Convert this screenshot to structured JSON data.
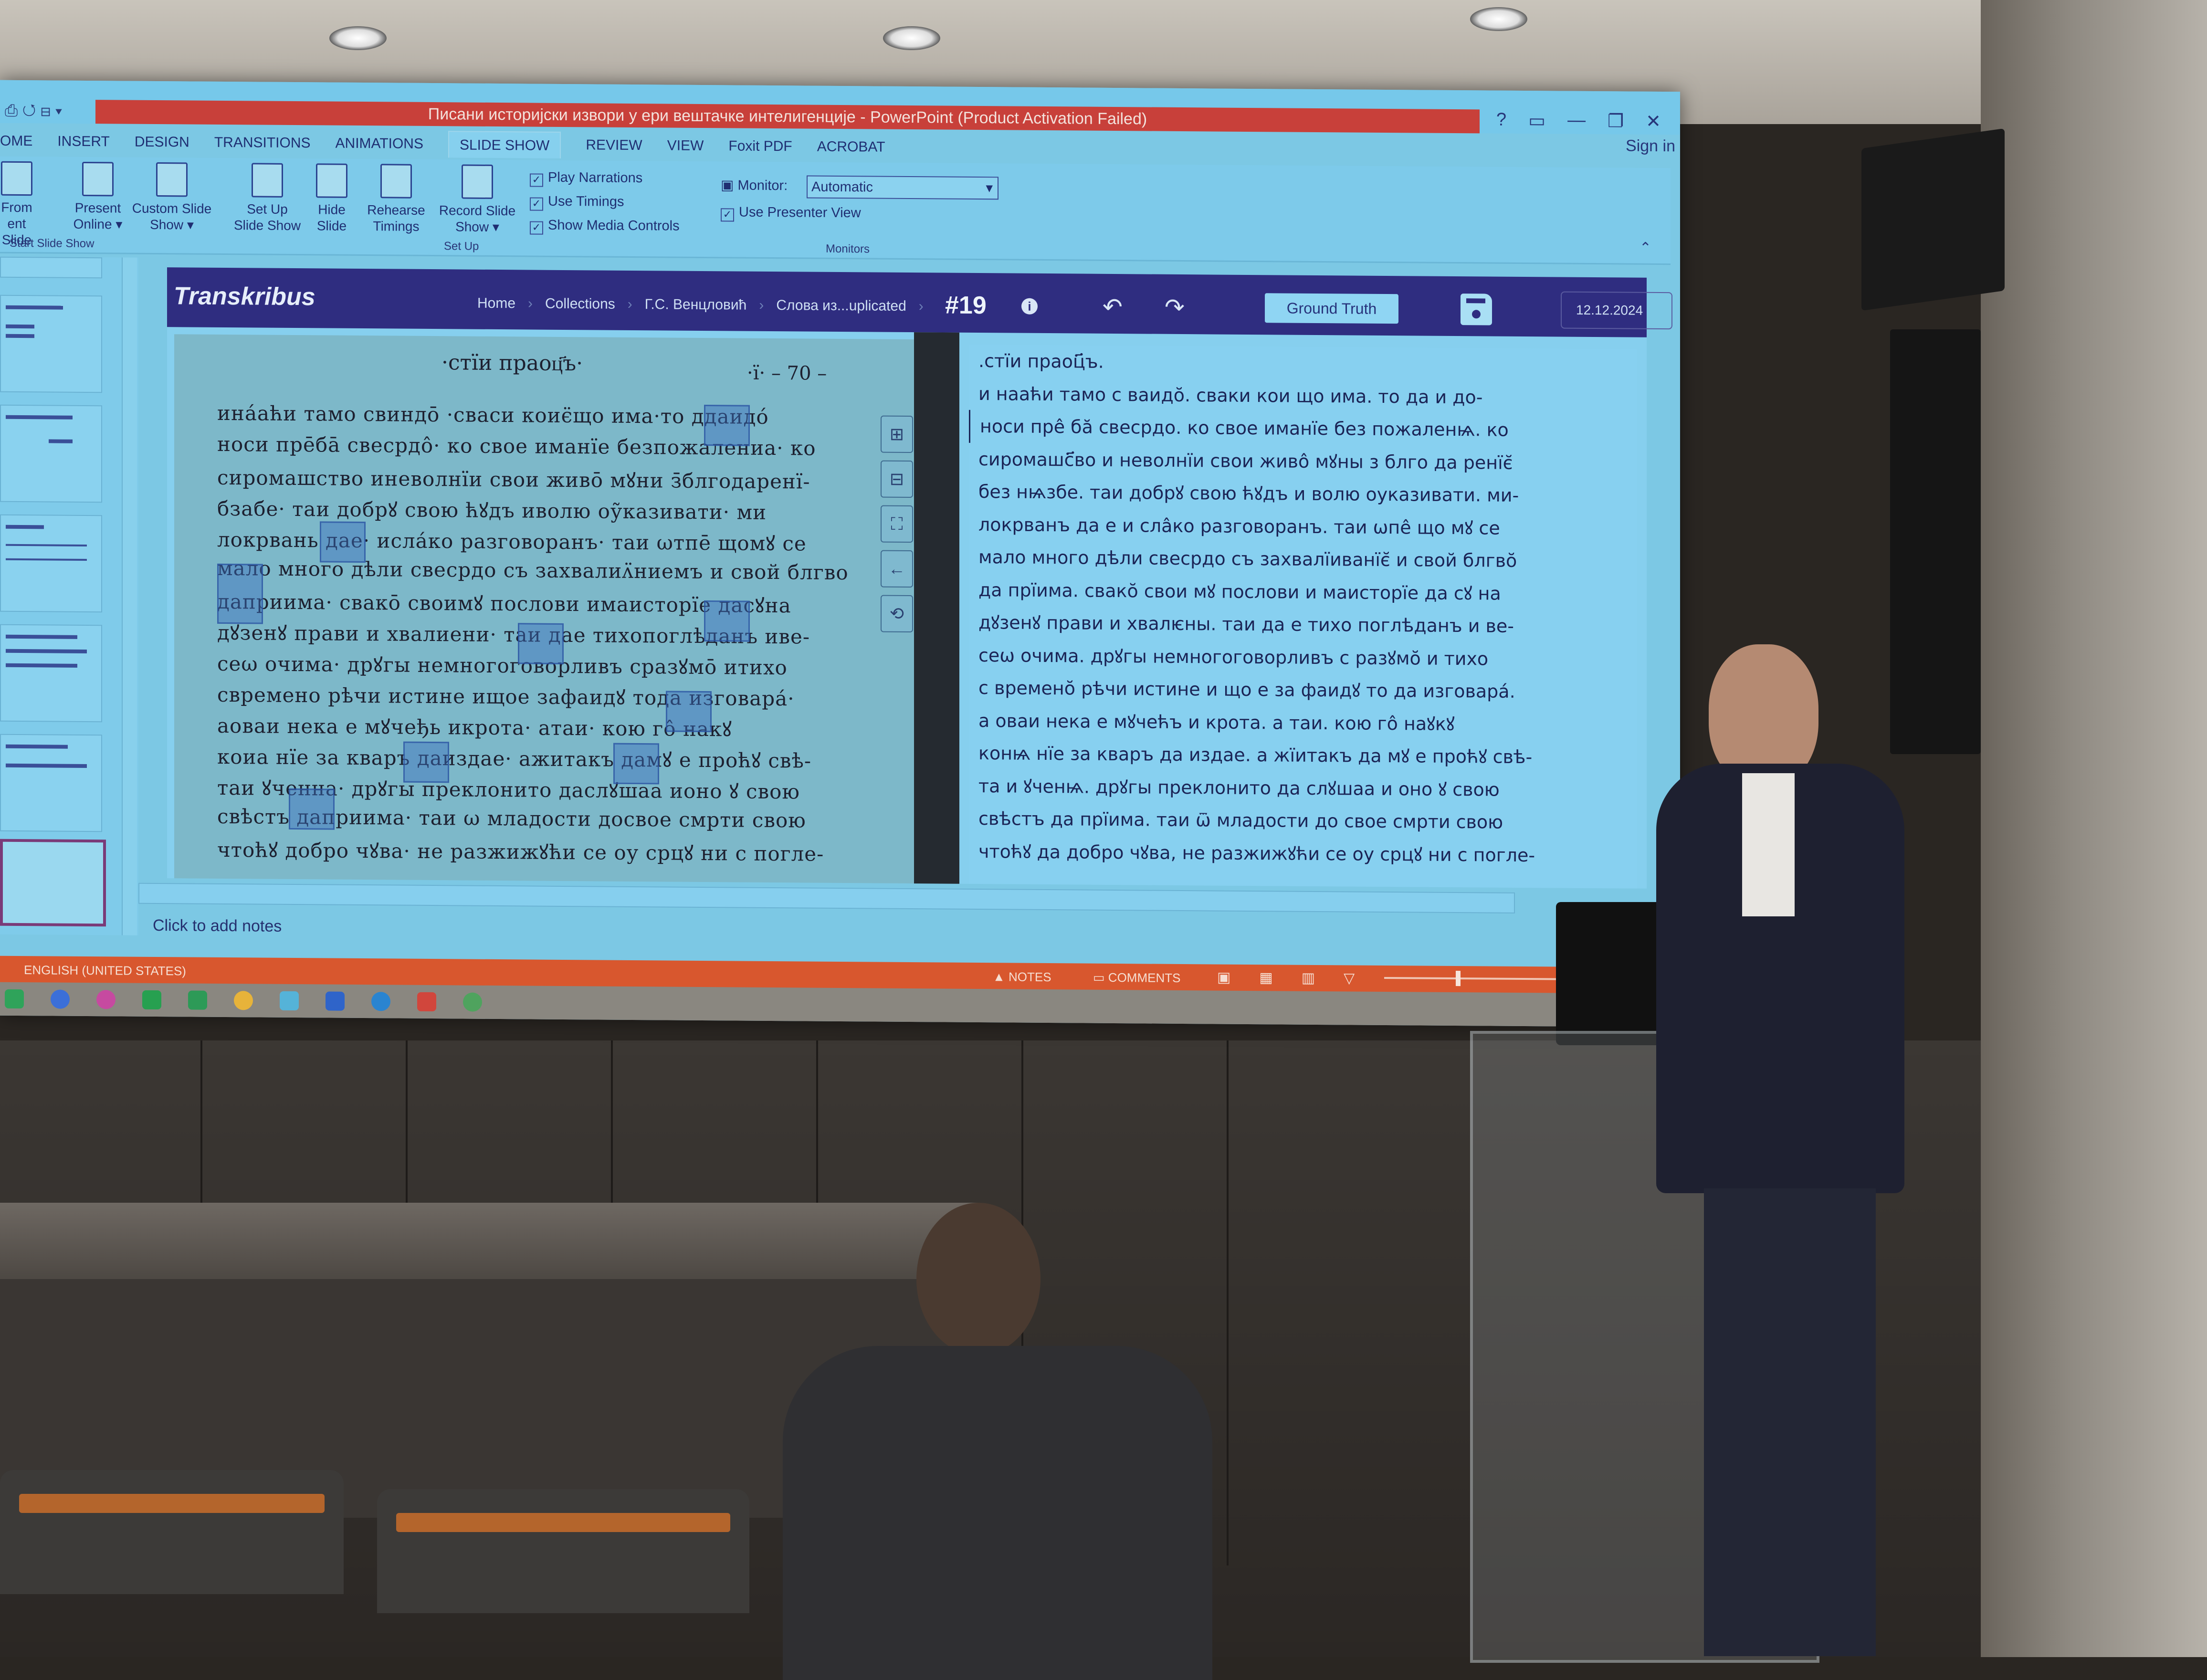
{
  "window": {
    "title": "Писани историјски извори у ери вештачке интелигенције - PowerPoint (Product Activation Failed)",
    "buttons": [
      "?",
      "ribbon-display",
      "—",
      "❐",
      "✕"
    ],
    "sign_in": "Sign in"
  },
  "ribbon_tabs": [
    {
      "label": "OME"
    },
    {
      "label": "INSERT"
    },
    {
      "label": "DESIGN"
    },
    {
      "label": "TRANSITIONS"
    },
    {
      "label": "ANIMATIONS"
    },
    {
      "label": "SLIDE SHOW",
      "active": true
    },
    {
      "label": "REVIEW"
    },
    {
      "label": "VIEW"
    },
    {
      "label": "Foxit PDF"
    },
    {
      "label": "ACROBAT"
    }
  ],
  "ribbon": {
    "buttons": [
      {
        "line1": "From",
        "line2": "ent Slide"
      },
      {
        "line1": "Present",
        "line2": "Online ▾"
      },
      {
        "line1": "Custom Slide",
        "line2": "Show ▾"
      },
      {
        "line1": "Set Up",
        "line2": "Slide Show"
      },
      {
        "line1": "Hide",
        "line2": "Slide"
      },
      {
        "line1": "Rehearse",
        "line2": "Timings"
      },
      {
        "line1": "Record Slide",
        "line2": "Show ▾"
      }
    ],
    "checkboxes": [
      {
        "label": "Play Narrations",
        "checked": true
      },
      {
        "label": "Use Timings",
        "checked": true
      },
      {
        "label": "Show Media Controls",
        "checked": true
      }
    ],
    "monitor_label": "Monitor:",
    "monitor_value": "Automatic",
    "presenter_view": {
      "label": "Use Presenter View",
      "checked": true
    },
    "groups": [
      "Start Slide Show",
      "Set Up",
      "Monitors"
    ]
  },
  "transkribus": {
    "logo": "Transkribus",
    "breadcrumbs": [
      "Home",
      "Collections",
      "Г.С. Венцловић",
      "Слова из...uplicated"
    ],
    "page_number": "#19",
    "ground_truth_button": "Ground Truth",
    "date": "12.12.2024",
    "manuscript_title": "·стїи праоц҃ъ·",
    "manuscript_folio": "·ї· – 70 –",
    "manuscript_lines": [
      "ина́аћи тамо свиндо̄ ·сваси коиє̈що има·то ддаидо́",
      "носи пре̄бā свесрдо̂· ко свое иманїе безпожалениа· ко",
      "сиромашство иневолнїи свои живо̄ мꙋни з̄блгодаренї-",
      "бзабе· таи добрꙋ свою ћꙋдъ иволю оу̃казивати· ми",
      "локрвань дае· исла́ко разговоранъ· таи ωтпе̄ щомꙋ се",
      "мало много дѣли свесрдо съ захвалиʌ̈ниемъ и свой блгво",
      "даприима· свакō своимꙋ послови имаисторїе дасꙋна",
      "дꙋзенꙋ прави и хвалиени· таи дае тихопоглѣданъ иве-",
      "сеω очима· дрꙋгы немногоговорливъ сразꙋмо̄ итихо",
      "свремено рѣчи истине ищое зафаидꙋ тода изговара́·",
      "аоваи нека е мꙋчеђь икрота· атаи· кою го̂ накꙋ",
      "коиа нїе за кваръ даиздае· ажитакъ дамꙋ е проћꙋ свѣ-",
      "таи ꙋченна· дрꙋгы преклонито даслꙋшаа ионо ꙋ свою",
      "свѣстъ даприима· таи ω младости досвое смрти свою",
      "чтоћꙋ добро чꙋва· не разжижꙋћи се оу срцꙋ ни с погле-"
    ],
    "transcription_lines": [
      ".стїи праоц҃ъ.",
      "и нааћи тамо с ваидо̆. сваки кои що има. то да и до-",
      "носи пре̂ бӑ свесрдо. ко свое иманїе без пожаленѩ. ко",
      "сиромашс҃во и неволнїи свои живо̂ мꙋны з блго да ренїє̆",
      "без нѩзбе. таи добрꙋ свою ћꙋдъ и волю оуказивати. ми-",
      "локрванъ да е и сла̂ко разговоранъ. таи ѡпе̂ що мꙋ се",
      "мало много дѣли свесрдо съ захвалїиванїє̆ и свой блгво̆",
      "да прїима. свако̆ свои мꙋ послови и маисторїе да сꙋ на",
      "дꙋзенꙋ прави и хвалѥны. таи да е тихо поглѣданъ и ве-",
      "сеѡ очима. дрꙋгы немногоговорливъ с разꙋмо̆ и тихо",
      "с времено̆ рѣчи истине и що е за фаидꙋ то да изговара́.",
      "а оваи нека е мꙋчећъ и крота. а таи. кою го̂ наꙋкꙋ",
      "конѩ нїе за кваръ да издае. а жїитакъ да мꙋ е проћꙋ свѣ-",
      "та и ꙋченѩ. дрꙋгы преклонито да слꙋшаа и оно ꙋ свою",
      "свѣстъ да прїима. таи ѿ младости до свое смрти свою",
      "чтоћꙋ да добро чꙋва, не разжижꙋћи се оу срцꙋ ни с погле-"
    ],
    "side_tools": [
      "zoom-in",
      "zoom-out",
      "fit",
      "back",
      "rotate"
    ]
  },
  "notes_placeholder": "Click to add notes",
  "statusbar": {
    "language": "ENGLISH (UNITED STATES)",
    "notes": "NOTES",
    "comments": "COMMENTS"
  },
  "colors": {
    "titlebar_red": "#c8403a",
    "transkribus_header": "#2f2d80",
    "statusbar_orange": "#d8572e"
  }
}
